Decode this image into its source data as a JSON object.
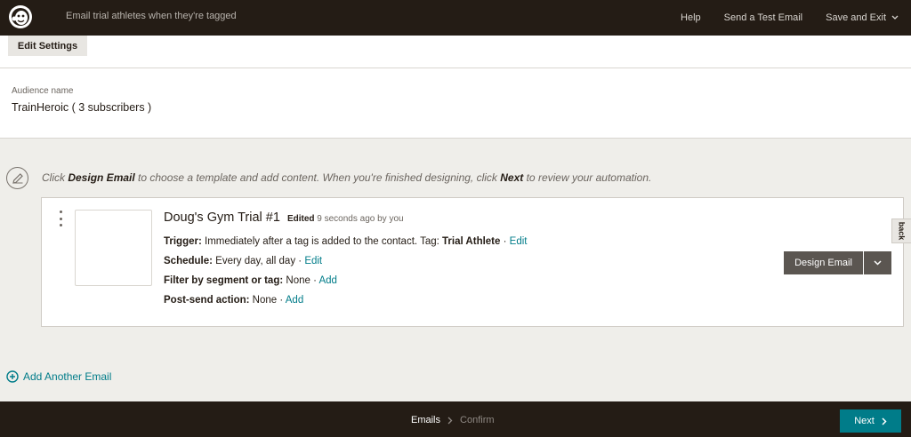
{
  "header": {
    "campaign_name": "Email trial athletes when they're tagged",
    "help": "Help",
    "send_test": "Send a Test Email",
    "save_exit": "Save and Exit"
  },
  "settings": {
    "edit_settings": "Edit Settings"
  },
  "audience": {
    "label": "Audience name",
    "value": "TrainHeroic ( 3 subscribers )"
  },
  "instructions": {
    "p1": "Click ",
    "b1": "Design Email",
    "p2": " to choose a template and add content. When you're finished designing, click ",
    "b2": "Next",
    "p3": " to review your automation."
  },
  "email": {
    "title": "Doug's Gym Trial #1",
    "edited_label": "Edited",
    "edited_time": " 9 seconds ago by you",
    "trigger_label": "Trigger:",
    "trigger_text": " Immediately after a tag is added to the contact. Tag: ",
    "trigger_tag": "Trial Athlete",
    "trigger_sep": " · ",
    "trigger_link": "Edit",
    "schedule_label": "Schedule:",
    "schedule_text": " Every day, all day",
    "schedule_sep": " · ",
    "schedule_link": "Edit",
    "filter_label": "Filter by segment or tag:",
    "filter_text": " None",
    "filter_sep": " · ",
    "filter_link": "Add",
    "post_label": "Post-send action:",
    "post_text": " None",
    "post_sep": " · ",
    "post_link": "Add",
    "design_button": "Design Email"
  },
  "feedback": {
    "label": "back"
  },
  "add_email": {
    "label": "Add Another Email"
  },
  "footer": {
    "step1": "Emails",
    "step2": "Confirm",
    "next": "Next"
  },
  "colors": {
    "dark": "#241c15",
    "teal": "#007c89",
    "button_gray": "#5b5651",
    "background": "#efeeea"
  },
  "icons": [
    "mailchimp-logo",
    "chevron-down-icon",
    "pencil-icon",
    "kebab-icon",
    "plus-circle-icon",
    "chevron-right-icon"
  ]
}
